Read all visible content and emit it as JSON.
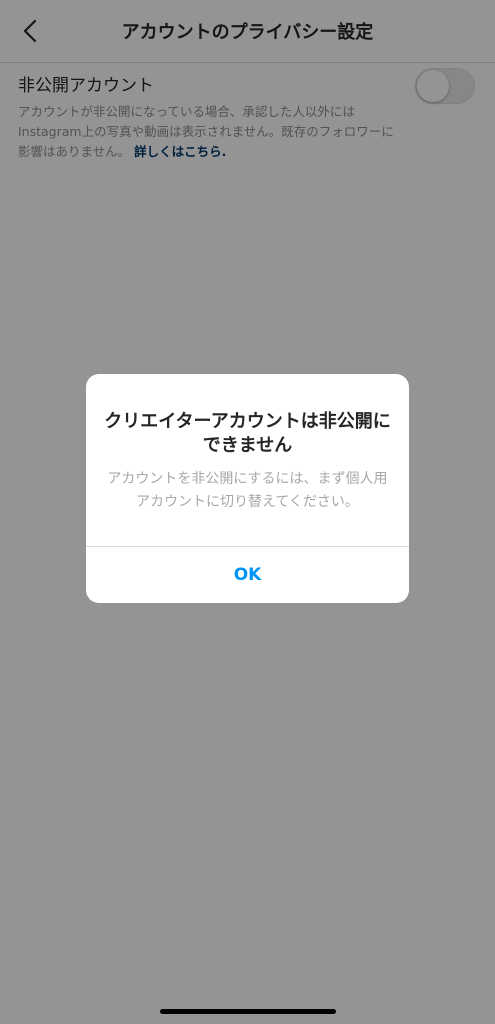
{
  "header": {
    "title": "アカウントのプライバシー設定"
  },
  "private_account": {
    "label": "非公開アカウント",
    "description": "アカウントが非公開になっている場合、承認した人以外にはInstagram上の写真や動画は表示されません。既存のフォロワーに影響はありません。",
    "link_text": "詳しくはこちら",
    "link_suffix": ".",
    "toggle_on": false
  },
  "dialog": {
    "title": "クリエイターアカウントは非公開にできません",
    "message": "アカウントを非公開にするには、まず個人用アカウントに切り替えてください。",
    "ok_label": "OK"
  },
  "colors": {
    "link": "#00376b",
    "accent": "#0095f6",
    "overlay": "rgba(0,0,0,0.42)"
  },
  "icons": {
    "back": "chevron-left-icon"
  }
}
